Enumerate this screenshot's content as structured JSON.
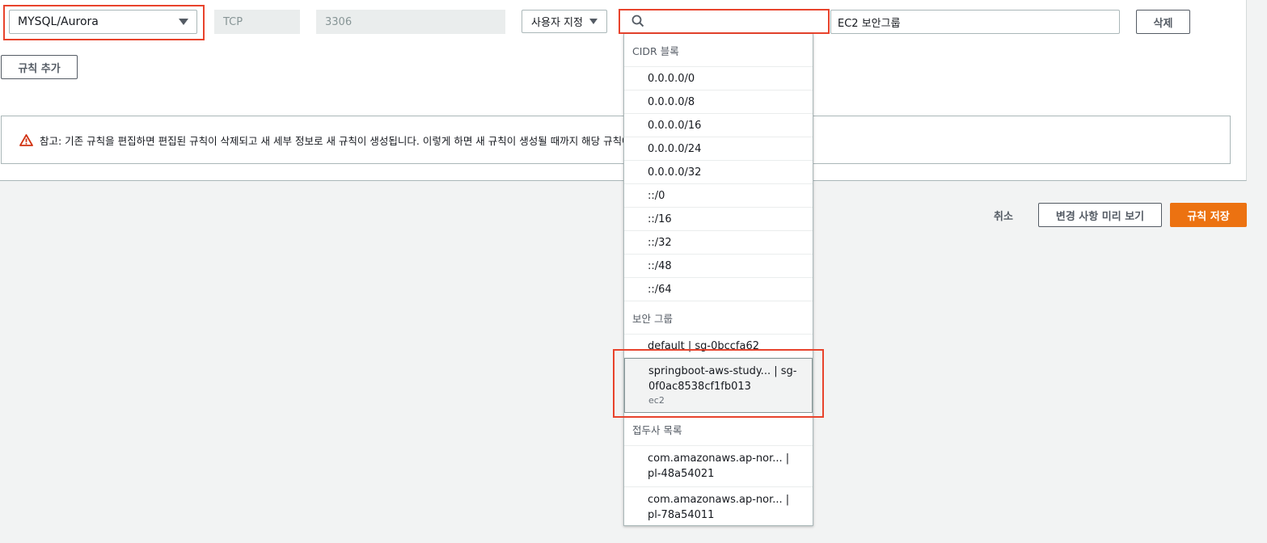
{
  "rule": {
    "type_value": "MYSQL/Aurora",
    "protocol": "TCP",
    "port_range": "3306",
    "source_type": "사용자 지정",
    "search_value": "",
    "description": "EC2 보안그룹",
    "delete_label": "삭제"
  },
  "add_rule_label": "규칙 추가",
  "notice_text": "참고: 기존 규칙을 편집하면 편집된 규칙이 삭제되고 새 세부 정보로 새 규칙이 생성됩니다. 이렇게 하면 새 규칙이 생성될 때까지 해당 규칙에 의존하는 트래픽이 삭제될 수 있습니다.",
  "footer": {
    "cancel_label": "취소",
    "preview_label": "변경 사항 미리 보기",
    "save_label": "규칙 저장"
  },
  "dropdown": {
    "cidr_header": "CIDR 블록",
    "cidr_options": [
      "0.0.0.0/0",
      "0.0.0.0/8",
      "0.0.0.0/16",
      "0.0.0.0/24",
      "0.0.0.0/32",
      "::/0",
      "::/16",
      "::/32",
      "::/48",
      "::/64"
    ],
    "sg_header": "보안 그룹",
    "sg_options": [
      {
        "label": "default | sg-0bccfa62",
        "sub": ""
      },
      {
        "label": "springboot-aws-study... | sg-0f0ac8538cf1fb013",
        "sub": "ec2"
      }
    ],
    "pl_header": "접두사 목록",
    "pl_options": [
      {
        "label": "com.amazonaws.ap-nor... | pl-48a54021"
      },
      {
        "label": "com.amazonaws.ap-nor... | pl-78a54011"
      }
    ]
  },
  "colors": {
    "accent": "#ec7211",
    "highlight": "#e8432c",
    "focus": "#44b9d6",
    "warning": "#d13212"
  }
}
